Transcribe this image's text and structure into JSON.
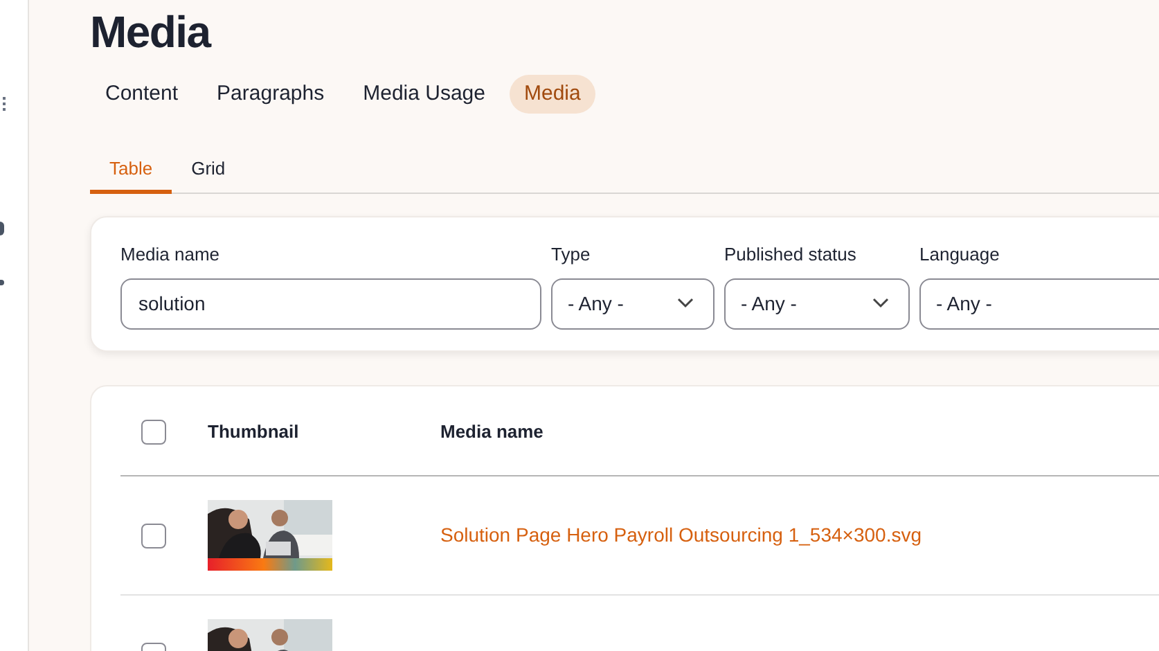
{
  "page_title": "Media",
  "primary_tabs": [
    {
      "label": "Content",
      "selected": false
    },
    {
      "label": "Paragraphs",
      "selected": false
    },
    {
      "label": "Media Usage",
      "selected": false
    },
    {
      "label": "Media",
      "selected": true
    }
  ],
  "secondary_tabs": [
    {
      "label": "Table",
      "selected": true
    },
    {
      "label": "Grid",
      "selected": false
    }
  ],
  "filters": [
    {
      "kind": "text",
      "label": "Media name",
      "value": "solution"
    },
    {
      "kind": "select",
      "label": "Type",
      "value": "- Any -"
    },
    {
      "kind": "select",
      "label": "Published status",
      "value": "- Any -"
    },
    {
      "kind": "select",
      "label": "Language",
      "value": "- Any -"
    }
  ],
  "table": {
    "select_all_checked": false,
    "columns": [
      "Thumbnail",
      "Media name"
    ],
    "rows": [
      {
        "checked": false,
        "name": "Solution Page Hero Payroll Outsourcing 1_534×300.svg"
      },
      {
        "checked": false
      }
    ]
  }
}
